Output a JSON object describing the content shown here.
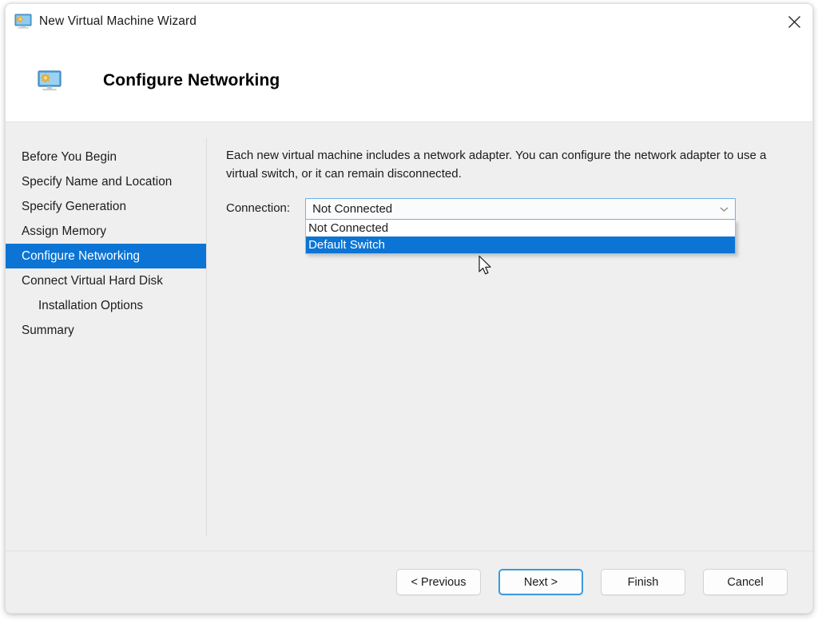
{
  "window": {
    "title": "New Virtual Machine Wizard",
    "title_icon": "virtual-machine-monitor-icon",
    "close_label": "✕"
  },
  "header": {
    "icon": "virtual-machine-monitor-icon",
    "title": "Configure Networking"
  },
  "sidebar": {
    "items": [
      {
        "label": "Before You Begin",
        "selected": false,
        "indented": false
      },
      {
        "label": "Specify Name and Location",
        "selected": false,
        "indented": false
      },
      {
        "label": "Specify Generation",
        "selected": false,
        "indented": false
      },
      {
        "label": "Assign Memory",
        "selected": false,
        "indented": false
      },
      {
        "label": "Configure Networking",
        "selected": true,
        "indented": false
      },
      {
        "label": "Connect Virtual Hard Disk",
        "selected": false,
        "indented": false
      },
      {
        "label": "Installation Options",
        "selected": false,
        "indented": true
      },
      {
        "label": "Summary",
        "selected": false,
        "indented": false
      }
    ]
  },
  "main": {
    "description": "Each new virtual machine includes a network adapter. You can configure the network adapter to use a virtual switch, or it can remain disconnected.",
    "connection": {
      "label": "Connection:",
      "selected_value": "Not Connected",
      "chevron_icon": "chevron-down-icon",
      "expanded": true,
      "options": [
        {
          "label": "Not Connected",
          "highlighted": false
        },
        {
          "label": "Default Switch",
          "highlighted": true
        }
      ]
    }
  },
  "footer": {
    "buttons": [
      {
        "label": "< Previous",
        "focused": false
      },
      {
        "label": "Next >",
        "focused": true
      },
      {
        "label": "Finish",
        "focused": false
      },
      {
        "label": "Cancel",
        "focused": false
      }
    ]
  },
  "colors": {
    "accent_blue": "#0b74d4",
    "focus_border": "#3a9bdc",
    "window_background": "#efefef",
    "panel_white": "#ffffff"
  },
  "cursor": {
    "type": "arrow-pointer"
  }
}
